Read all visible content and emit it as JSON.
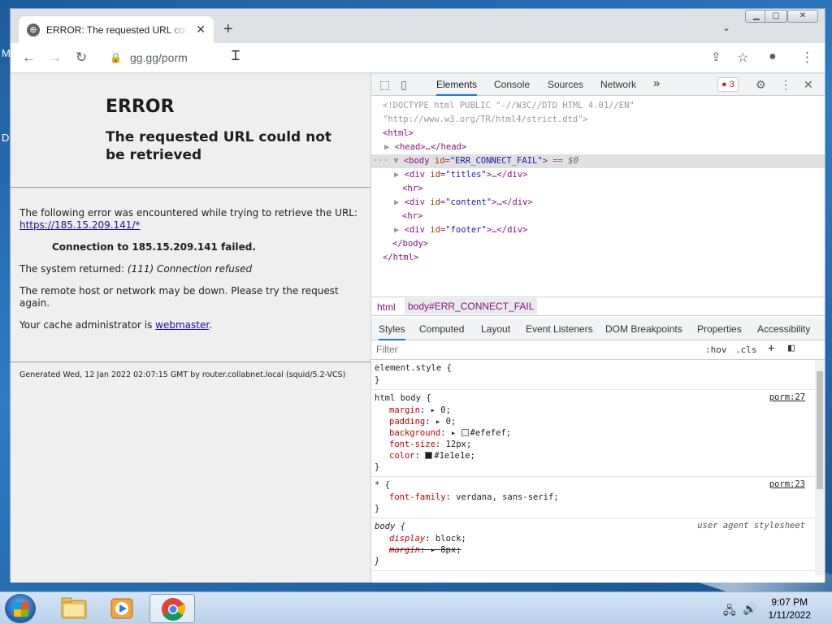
{
  "desktop": {
    "letters": [
      "M",
      "D"
    ]
  },
  "browser": {
    "tab_title": "ERROR: The requested URL could not be retrieved",
    "tab_close": "✕",
    "new_tab": "+",
    "url": "gg.gg/porm",
    "icons": {
      "back": "arrow-left",
      "forward": "arrow-right",
      "reload": "reload",
      "share": "share",
      "bookmark": "star",
      "profile": "person",
      "menu": "kebab"
    }
  },
  "page": {
    "h1": "ERROR",
    "h2": "The requested URL could not be retrieved",
    "p1": "The following error was encountered while trying to retrieve the URL: ",
    "p1_link": "https://185.15.209.141/*",
    "conn_failed": "Connection to 185.15.209.141 failed.",
    "sys_returned_label": "The system returned: ",
    "sys_returned_value": "(111) Connection refused",
    "remote_down": "The remote host or network may be down. Please try the request again.",
    "admin_text": "Your cache administrator is ",
    "admin_link": "webmaster",
    "admin_end": ".",
    "footer": "Generated Wed, 12 Jan 2022 02:07:15 GMT by router.collabnet.local (squid/5.2-VCS)"
  },
  "devtools": {
    "tabs": [
      "Elements",
      "Console",
      "Sources",
      "Network"
    ],
    "more_tabs": "»",
    "error_count": "3",
    "dom": {
      "doctype1": "<!DOCTYPE html PUBLIC \"-//W3C//DTD HTML 4.01//EN\"",
      "doctype2": "\"http://www.w3.org/TR/html4/strict.dtd\">",
      "html_open": "<html>",
      "head": "<head>…</head>",
      "body_tag": "<body",
      "body_attr": "id",
      "body_val": "\"ERR_CONNECT_FAIL\"",
      "body_eq": "== $0",
      "div_titles": "\"titles\"",
      "div_content": "\"content\"",
      "div_footer": "\"footer\"",
      "hr": "<hr>",
      "body_close": "</body>",
      "html_close": "</html>"
    },
    "breadcrumbs": [
      "html",
      "body#ERR_CONNECT_FAIL"
    ],
    "subtabs": [
      "Styles",
      "Computed",
      "Layout",
      "Event Listeners",
      "DOM Breakpoints",
      "Properties",
      "Accessibility"
    ],
    "filter_placeholder": "Filter",
    "hov": ":hov",
    "cls": ".cls",
    "plus": "+",
    "rules": {
      "r0_sel": "element.style {",
      "r1_sel": "html body {",
      "r1_src": "porm:27",
      "margin": "0",
      "padding": "0",
      "background": "#efefef",
      "font_size": "12px",
      "color": "#1e1e1e",
      "r2_sel": "* {",
      "r2_src": "porm:23",
      "font_family": "verdana, sans-serif",
      "r3_sel": "body {",
      "r3_src": "user agent stylesheet",
      "display": "block",
      "ua_margin": "8px"
    }
  },
  "taskbar": {
    "time": "9:07 PM",
    "date": "1/11/2022"
  },
  "colors": {
    "swatch_bg": "#efefef",
    "swatch_color": "#1e1e1e",
    "accent": "#1a73e8"
  }
}
